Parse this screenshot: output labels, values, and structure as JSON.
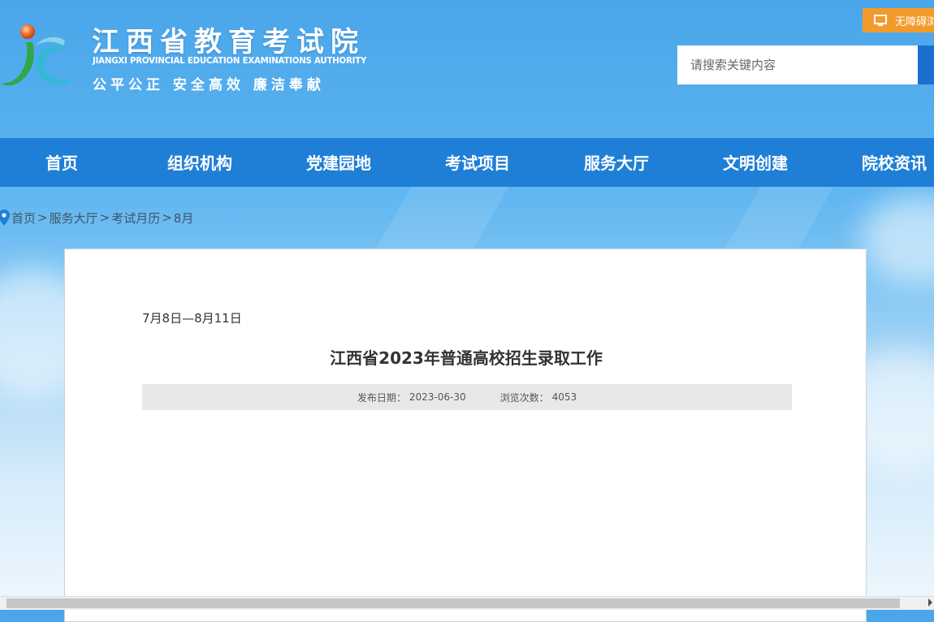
{
  "header": {
    "title_cn": "江西省教育考试院",
    "title_en": "JIANGXI PROVINCIAL EDUCATION EXAMINATIONS AUTHORITY",
    "slogan": "公平公正  安全高效  廉洁奉献",
    "logo_icon": "jx-logo-icon",
    "accessibility_label": "无障碍浏览",
    "search_placeholder": "请搜索关键内容"
  },
  "nav": {
    "items": [
      {
        "label": "首页"
      },
      {
        "label": "组织机构"
      },
      {
        "label": "党建园地"
      },
      {
        "label": "考试项目"
      },
      {
        "label": "服务大厅"
      },
      {
        "label": "文明创建"
      },
      {
        "label": "院校资讯"
      }
    ]
  },
  "breadcrumb": {
    "icon": "location-pin-icon",
    "items": [
      "首页",
      "服务大厅",
      "考试月历",
      "8月"
    ],
    "separator": ">"
  },
  "article": {
    "date_range": "7月8日—8月11日",
    "title": "江西省2023年普通高校招生录取工作",
    "publish_label": "发布日期：",
    "publish_date": "2023-06-30",
    "views_label": "浏览次数：",
    "views": "4053"
  },
  "colors": {
    "nav_bg": "#1f7fd6",
    "access_btn": "#f29b2b",
    "search_btn": "#1a6fd0"
  }
}
